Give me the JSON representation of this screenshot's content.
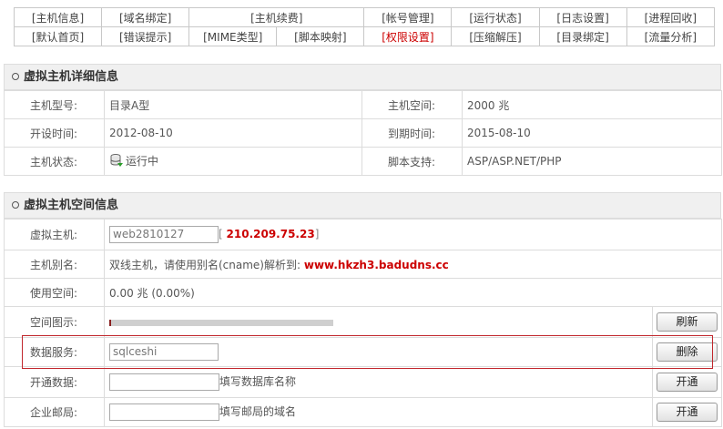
{
  "nav": {
    "row1": [
      "[主机信息]",
      "[域名绑定]",
      "[主机续费]",
      "[帐号管理]",
      "[运行状态]",
      "[日志设置]",
      "[进程回收]"
    ],
    "row2": [
      "[默认首页]",
      "[错误提示]",
      "[MIME类型]",
      "[脚本映射]",
      "[权限设置]",
      "[压缩解压]",
      "[目录绑定]",
      "[流量分析]"
    ],
    "active": "[权限设置]"
  },
  "detail": {
    "title": "虚拟主机详细信息",
    "model_label": "主机型号:",
    "model_value": "目录A型",
    "space_label": "主机空间:",
    "space_value": "2000 兆",
    "open_label": "开设时间:",
    "open_value": "2012-08-10",
    "expire_label": "到期时间:",
    "expire_value": "2015-08-10",
    "status_label": "主机状态:",
    "status_icon": "database-icon",
    "status_value": "运行中",
    "script_label": "脚本支持:",
    "script_value": "ASP/ASP.NET/PHP"
  },
  "space": {
    "title": "虚拟主机空间信息",
    "host_label": "虚拟主机:",
    "host_value": "web2810127",
    "ip_open": "[",
    "ip_value": "210.209.75.23",
    "ip_close": "]",
    "alias_label": "主机别名:",
    "alias_text": "双线主机，请使用别名(cname)解析到:",
    "alias_value": "www.hkzh3.badudns.cc",
    "used_label": "使用空间:",
    "used_value": "0.00 兆  (0.00%)",
    "used_fraction": 0.0,
    "chart_label": "空间图示:",
    "refresh_button": "刷新",
    "db_label": "数据服务:",
    "db_value": "sqlceshi",
    "delete_button": "删除",
    "opendb_label": "开通数据:",
    "opendb_placeholder": "",
    "opendb_hint": "填写数据库名称",
    "opendb_button": "开通",
    "mail_label": "企业邮局:",
    "mail_placeholder": "",
    "mail_hint": "填写邮局的域名",
    "mail_button": "开通"
  },
  "colors": {
    "accent_red": "#cc0000",
    "highlight": "#c1272d"
  }
}
